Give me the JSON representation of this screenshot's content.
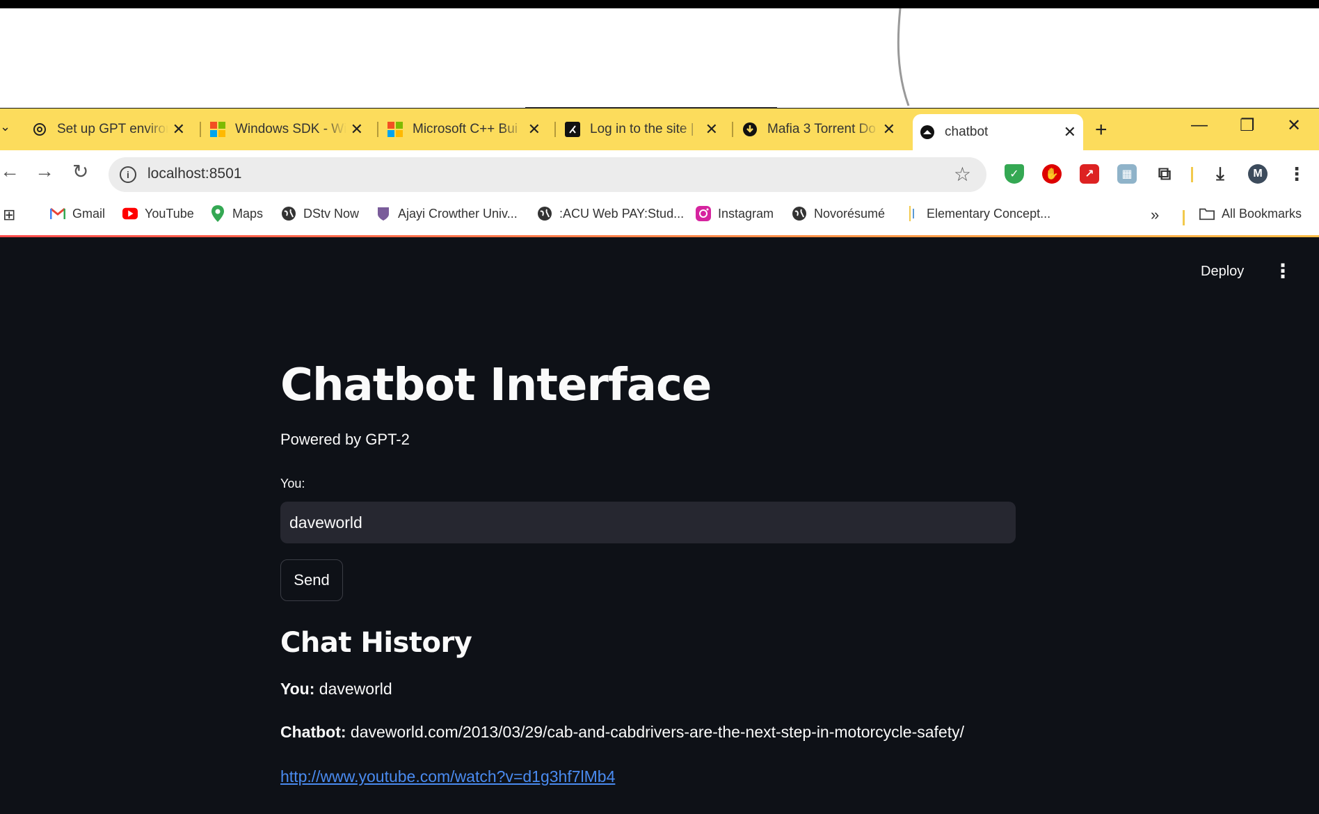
{
  "browser": {
    "tabs": [
      {
        "title": "Set up GPT environ",
        "icon": "openai-icon"
      },
      {
        "title": "Windows SDK - Wi",
        "icon": "microsoft-icon"
      },
      {
        "title": "Microsoft C++ Bui",
        "icon": "microsoft-icon"
      },
      {
        "title": "Log in to the site |",
        "icon": "kick-icon"
      },
      {
        "title": "Mafia 3 Torrent Do",
        "icon": "download-icon"
      },
      {
        "title": "chatbot",
        "icon": "streamlit-icon",
        "active": true
      }
    ],
    "close_glyph": "✕",
    "new_tab_glyph": "+",
    "url": "localhost:8501",
    "bookmarks": [
      {
        "label": "Gmail",
        "icon": "gmail-icon"
      },
      {
        "label": "YouTube",
        "icon": "youtube-icon"
      },
      {
        "label": "Maps",
        "icon": "maps-icon"
      },
      {
        "label": "DStv Now",
        "icon": "globe-icon"
      },
      {
        "label": "Ajayi Crowther Univ...",
        "icon": "university-icon"
      },
      {
        "label": ":ACU Web PAY:Stud...",
        "icon": "globe-icon"
      },
      {
        "label": "Instagram",
        "icon": "instagram-icon"
      },
      {
        "label": "Novorésumé",
        "icon": "globe-icon"
      },
      {
        "label": "Elementary Concept...",
        "icon": "bookmark-icon"
      }
    ],
    "all_bookmarks": "All Bookmarks",
    "profile_initial": "M",
    "colors": {
      "tabstrip": "#fcdc5c",
      "app_bg": "#0e1117",
      "link": "#4a8bf0"
    }
  },
  "app": {
    "deploy_label": "Deploy",
    "title": "Chatbot Interface",
    "subtitle": "Powered by GPT-2",
    "input_label": "You:",
    "input_value": "daveworld",
    "send_label": "Send",
    "history_heading": "Chat History",
    "messages": [
      {
        "speaker": "You:",
        "text": "daveworld"
      },
      {
        "speaker": "Chatbot:",
        "text": "daveworld.com/2013/03/29/cab-and-cabdrivers-are-the-next-step-in-motorcycle-safety/"
      }
    ],
    "link": "http://www.youtube.com/watch?v=d1g3hf7lMb4"
  }
}
